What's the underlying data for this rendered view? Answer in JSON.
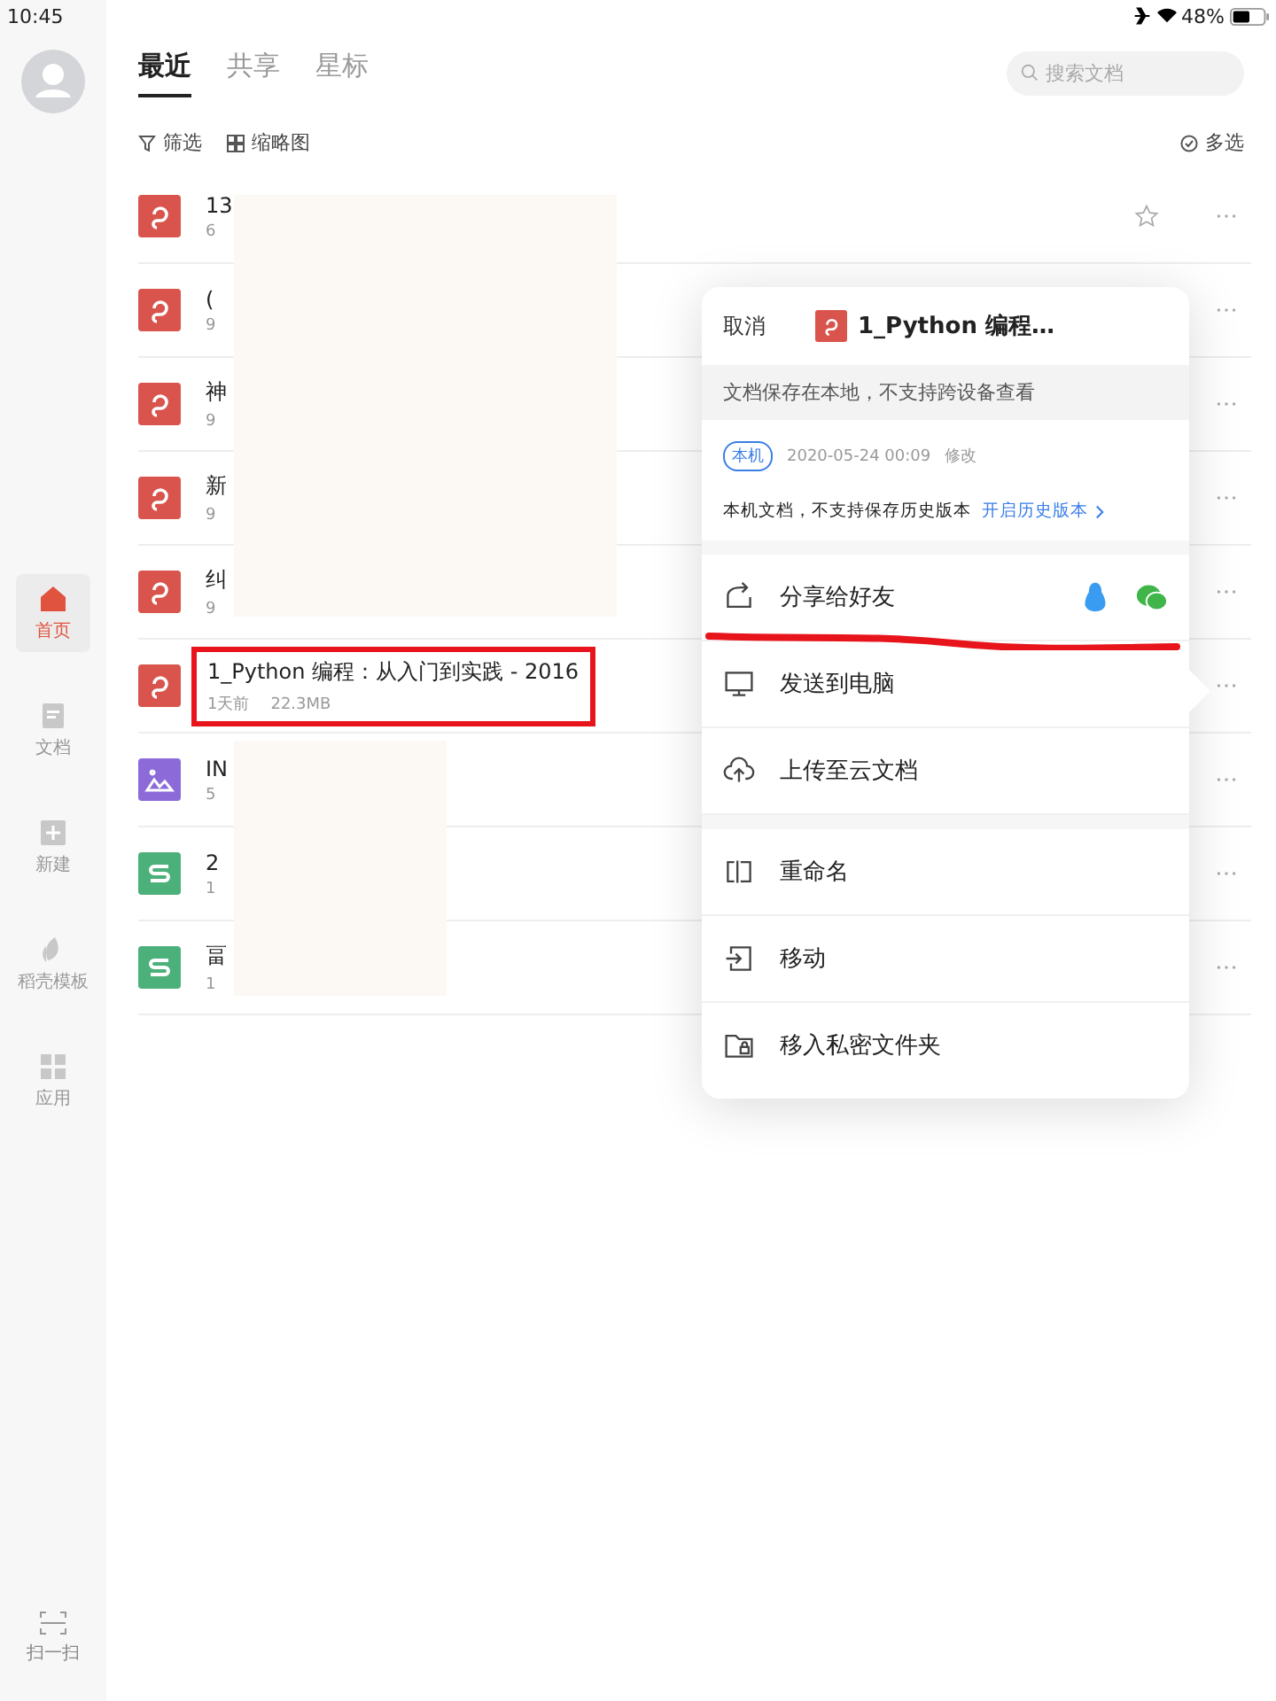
{
  "status_bar": {
    "time": "10:45",
    "battery": "48%"
  },
  "sidebar": {
    "items": [
      {
        "label": "首页",
        "kind": "home",
        "selected": true
      },
      {
        "label": "文档",
        "kind": "doc",
        "selected": false
      },
      {
        "label": "新建",
        "kind": "new",
        "selected": false
      },
      {
        "label": "稻壳模板",
        "kind": "template",
        "selected": false
      },
      {
        "label": "应用",
        "kind": "apps",
        "selected": false
      }
    ],
    "scan": "扫一扫"
  },
  "tabs": [
    {
      "label": "最近",
      "selected": true
    },
    {
      "label": "共享",
      "selected": false
    },
    {
      "label": "星标",
      "selected": false
    }
  ],
  "search": {
    "placeholder": "搜索文档"
  },
  "toolbar": {
    "filter": "筛选",
    "thumbnail": "缩略图",
    "multi_select": "多选"
  },
  "files": [
    {
      "kind": "pdf",
      "name": "13",
      "meta": "6",
      "starred": false,
      "highlighted": false
    },
    {
      "kind": "pdf",
      "name": "(",
      "meta": "9",
      "highlighted": false
    },
    {
      "kind": "pdf",
      "name": "神",
      "meta": "9",
      "highlighted": false
    },
    {
      "kind": "pdf",
      "name": "新",
      "meta": "9",
      "highlighted": false
    },
    {
      "kind": "pdf",
      "name": "纠",
      "meta": "9",
      "highlighted": false
    },
    {
      "kind": "pdf",
      "name": "1_Python 编程：从入门到实践 - 2016",
      "meta": "1天前",
      "size": "22.3MB",
      "highlighted": true
    },
    {
      "kind": "image",
      "name": "IN",
      "meta": "5",
      "highlighted": false
    },
    {
      "kind": "sheet",
      "name": "2",
      "meta": "1",
      "highlighted": false
    },
    {
      "kind": "sheet",
      "name": "畐",
      "meta": "1",
      "highlighted": false
    }
  ],
  "popover": {
    "cancel": "取消",
    "title": "1_Python 编程…",
    "notice": "文档保存在本地，不支持跨设备查看",
    "location_tag": "本机",
    "modified_time": "2020-05-24 00:09",
    "modified_label": "修改",
    "history_note": "本机文档，不支持保存历史版本",
    "history_link": "开启历史版本",
    "groups": [
      [
        {
          "kind": "share",
          "label": "分享给好友",
          "underlined": true
        },
        {
          "kind": "computer",
          "label": "发送到电脑",
          "underlined": false
        },
        {
          "kind": "upload",
          "label": "上传至云文档",
          "underlined": false
        }
      ],
      [
        {
          "kind": "rename",
          "label": "重命名",
          "underlined": false
        },
        {
          "kind": "move",
          "label": "移动",
          "underlined": false
        },
        {
          "kind": "private",
          "label": "移入私密文件夹",
          "underlined": false
        }
      ]
    ]
  }
}
